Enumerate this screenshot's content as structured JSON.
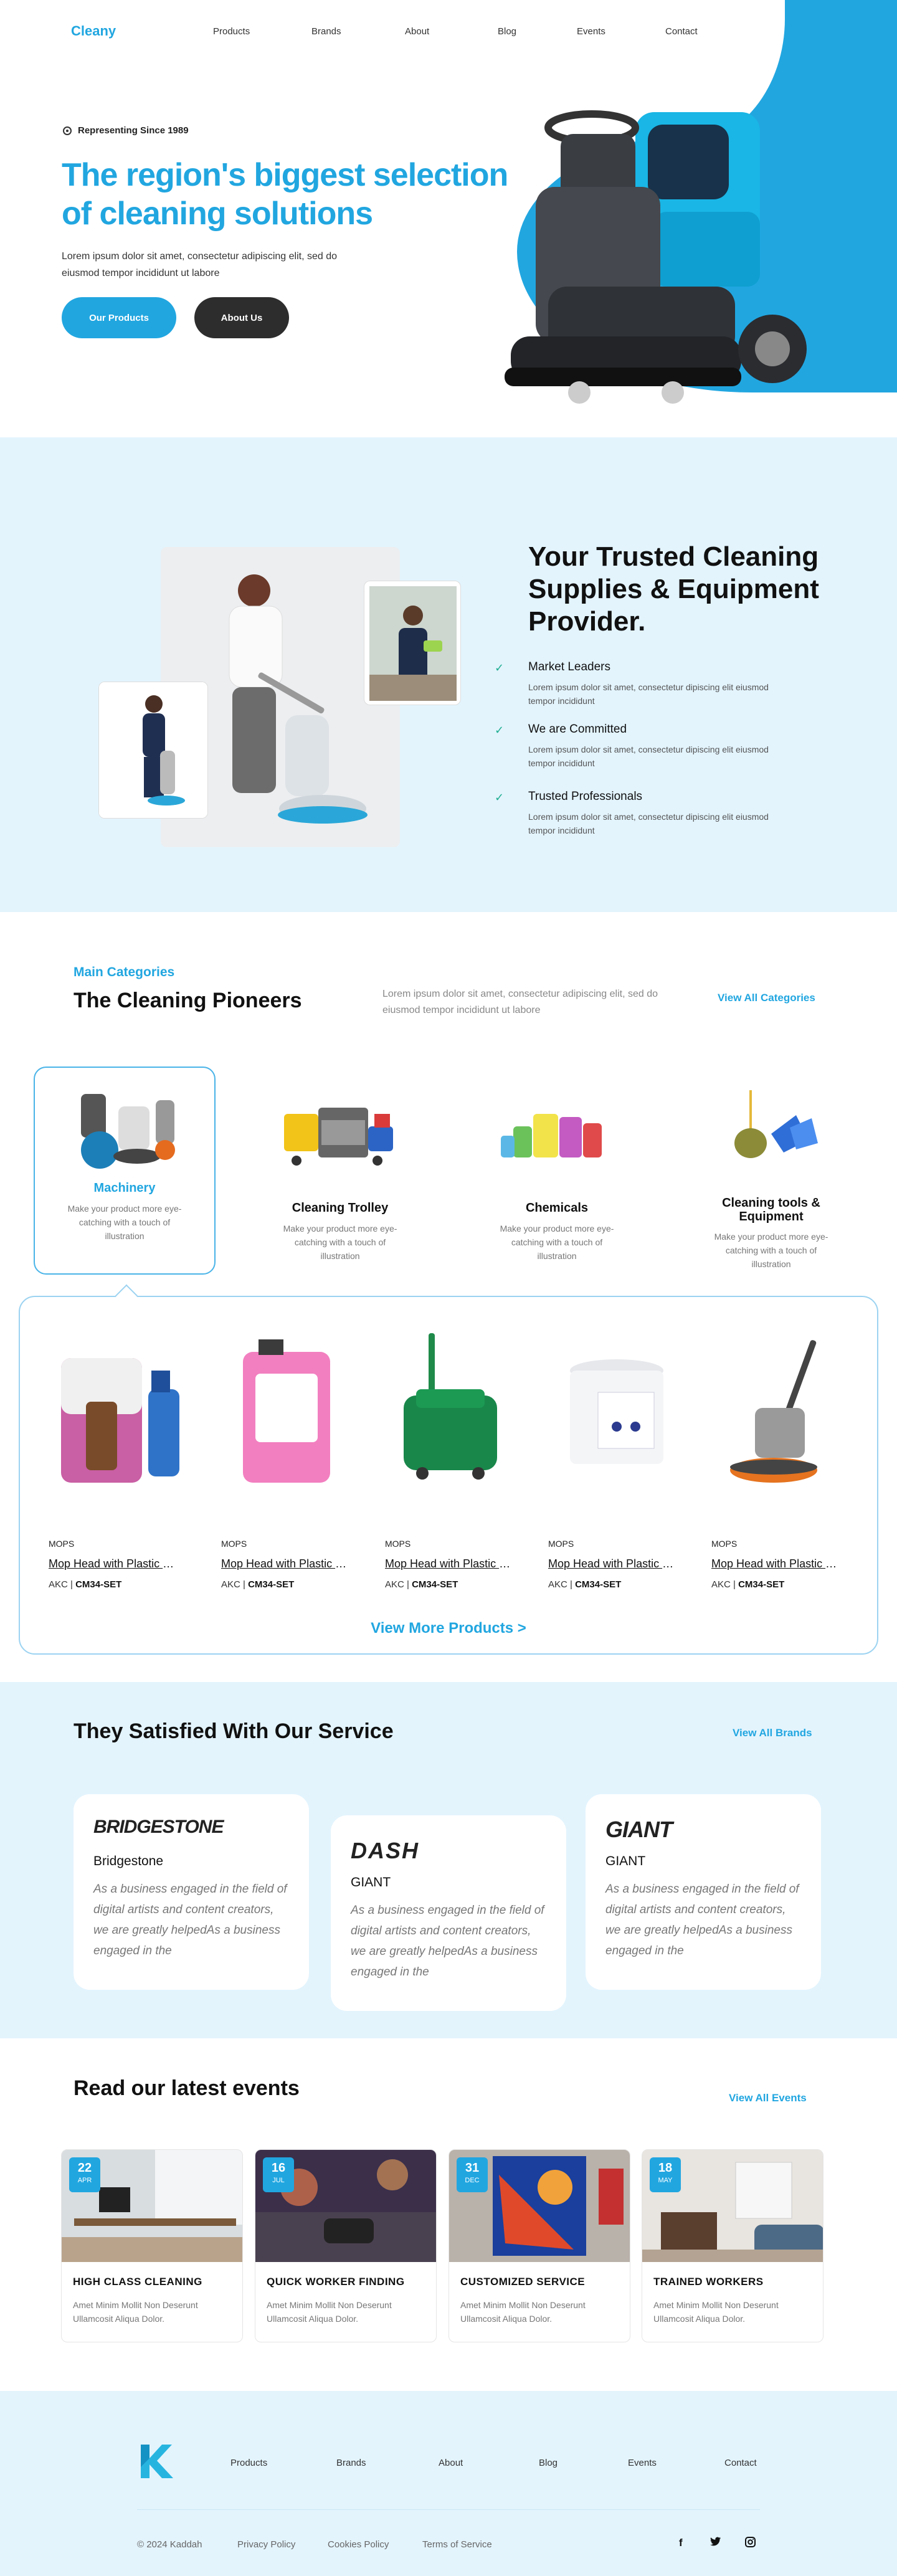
{
  "nav": {
    "logo": "Cleany",
    "items": [
      "Products",
      "Brands",
      "About",
      "Blog",
      "Events",
      "Contact"
    ]
  },
  "hero": {
    "eyebrow": "Representing Since 1989",
    "title": "The region's biggest selection of cleaning solutions",
    "text": "Lorem ipsum dolor sit amet, consectetur adipiscing elit, sed do eiusmod tempor incididunt ut labore",
    "btn_primary": "Our Products",
    "btn_secondary": "About Us"
  },
  "trusted": {
    "title": "Your Trusted Cleaning Supplies & Equipment Provider.",
    "features": [
      {
        "title": "Market Leaders",
        "text": "Lorem ipsum dolor sit amet, consectetur dipiscing elit eiusmod tempor incididunt"
      },
      {
        "title": "We are Committed",
        "text": "Lorem ipsum dolor sit amet, consectetur dipiscing elit eiusmod tempor incididunt"
      },
      {
        "title": "Trusted Professionals",
        "text": "Lorem ipsum dolor sit amet, consectetur dipiscing elit eiusmod tempor incididunt"
      }
    ]
  },
  "categories": {
    "kicker": "Main Categories",
    "title": "The Cleaning Pioneers",
    "text": "Lorem ipsum dolor sit amet, consectetur adipiscing elit, sed do eiusmod tempor incididunt ut labore",
    "link": "View All Categories",
    "items": [
      {
        "title": "Machinery",
        "text": "Make your product more eye-catching with a touch of illustration"
      },
      {
        "title": "Cleaning Trolley",
        "text": "Make your product more eye-catching with a touch of illustration"
      },
      {
        "title": "Chemicals",
        "text": "Make your product more eye-catching with a touch of illustration"
      },
      {
        "title": "Cleaning tools & Equipment",
        "text": "Make your product more eye-catching with a touch of illustration"
      }
    ]
  },
  "products": {
    "items": [
      {
        "category": "MOPS",
        "name": "Mop Head with Plastic Socket",
        "code_prefix": "AKC | ",
        "code": "CM34-SET"
      },
      {
        "category": "MOPS",
        "name": "Mop Head with Plastic Socket",
        "code_prefix": "AKC | ",
        "code": "CM34-SET"
      },
      {
        "category": "MOPS",
        "name": "Mop Head with Plastic Socket",
        "code_prefix": "AKC | ",
        "code": "CM34-SET"
      },
      {
        "category": "MOPS",
        "name": "Mop Head with Plastic Socket",
        "code_prefix": "AKC | ",
        "code": "CM34-SET"
      },
      {
        "category": "MOPS",
        "name": "Mop Head with Plastic Socket",
        "code_prefix": "AKC | ",
        "code": "CM34-SET"
      }
    ],
    "more": "View More Products >"
  },
  "brands": {
    "title": "They Satisfied With Our Service",
    "link": "View All Brands",
    "items": [
      {
        "logo": "BRIDGESTONE",
        "name": "Bridgestone",
        "text": "As a business engaged in the field of digital artists and content creators, we are greatly helpedAs a business engaged in the"
      },
      {
        "logo": "DASH",
        "name": "GIANT",
        "text": "As a business engaged in the field of digital artists and content creators, we are greatly helpedAs a business engaged in the"
      },
      {
        "logo": "GIANT",
        "name": "GIANT",
        "text": "As a business engaged in the field of digital artists and content creators, we are greatly helpedAs a business engaged in the"
      }
    ]
  },
  "events": {
    "title": "Read our latest events",
    "link": "View All Events",
    "items": [
      {
        "day": "22",
        "month": "APR",
        "title": "HIGH CLASS CLEANING",
        "text": "Amet Minim Mollit Non Deserunt Ullamcosit Aliqua Dolor."
      },
      {
        "day": "16",
        "month": "JUL",
        "title": "QUICK WORKER FINDING",
        "text": "Amet Minim Mollit Non Deserunt Ullamcosit Aliqua Dolor."
      },
      {
        "day": "31",
        "month": "DEC",
        "title": "CUSTOMIZED SERVICE",
        "text": "Amet Minim Mollit Non Deserunt Ullamcosit Aliqua Dolor."
      },
      {
        "day": "18",
        "month": "MAY",
        "title": "TRAINED WORKERS",
        "text": "Amet Minim Mollit Non Deserunt Ullamcosit Aliqua Dolor."
      }
    ]
  },
  "footer": {
    "nav": [
      "Products",
      "Brands",
      "About",
      "Blog",
      "Events",
      "Contact"
    ],
    "copyright": "© 2024 Kaddah",
    "privacy": "Privacy Policy",
    "cookies": "Cookies Policy",
    "terms": "Terms of Service",
    "social": [
      "facebook-icon",
      "twitter-icon",
      "instagram-icon"
    ]
  },
  "colors": {
    "accent": "#21a6e0",
    "dark": "#2d2d2d",
    "light_bg": "#e3f4fd"
  }
}
